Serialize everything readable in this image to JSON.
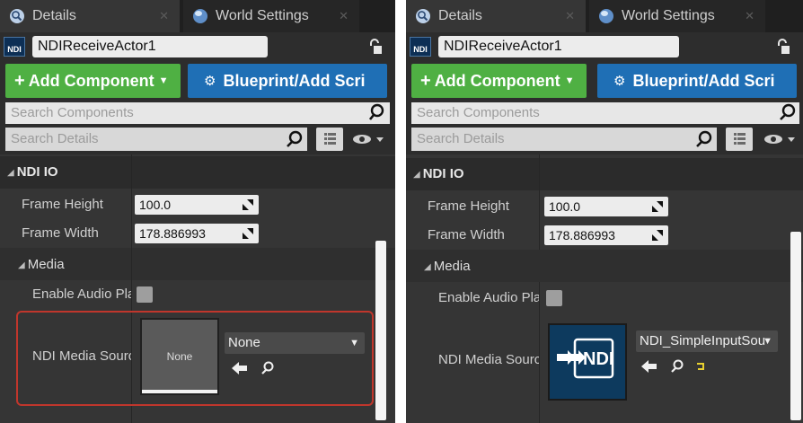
{
  "panels": [
    {
      "tabs": {
        "details": "Details",
        "world_settings": "World Settings"
      },
      "actor_name": "NDIReceiveActor1",
      "ndi_badge": "NDI",
      "buttons": {
        "add_component": "Add Component",
        "blueprint": "Blueprint/Add Scri"
      },
      "search": {
        "components_placeholder": "Search Components",
        "details_placeholder": "Search Details"
      },
      "category": "NDI IO",
      "frame_height": {
        "label": "Frame Height",
        "value": "100.0"
      },
      "frame_width": {
        "label": "Frame Width",
        "value": "178.886993"
      },
      "subcategory": "Media",
      "enable_audio": {
        "label": "Enable Audio Pla",
        "checked": false
      },
      "media_source": {
        "label": "NDI Media Sourc",
        "thumbnail_text": "None",
        "selected": "None"
      }
    },
    {
      "tabs": {
        "details": "Details",
        "world_settings": "World Settings"
      },
      "actor_name": "NDIReceiveActor1",
      "ndi_badge": "NDI",
      "buttons": {
        "add_component": "Add Component",
        "blueprint": "Blueprint/Add Scri"
      },
      "search": {
        "components_placeholder": "Search Components",
        "details_placeholder": "Search Details"
      },
      "category": "NDI IO",
      "frame_height": {
        "label": "Frame Height",
        "value": "100.0"
      },
      "frame_width": {
        "label": "Frame Width",
        "value": "178.886993"
      },
      "subcategory": "Media",
      "enable_audio": {
        "label": "Enable Audio Pla",
        "checked": false
      },
      "media_source": {
        "label": "NDI Media Sourc",
        "thumbnail_text": "NDI",
        "selected": "NDI_SimpleInputSou"
      }
    }
  ],
  "colors": {
    "panel_bg": "#2d2d2d",
    "add_button": "#4fb043",
    "blueprint_button": "#1f6fb5",
    "highlight_border": "#c0362c",
    "ndi_asset": "#0d3a5e"
  }
}
